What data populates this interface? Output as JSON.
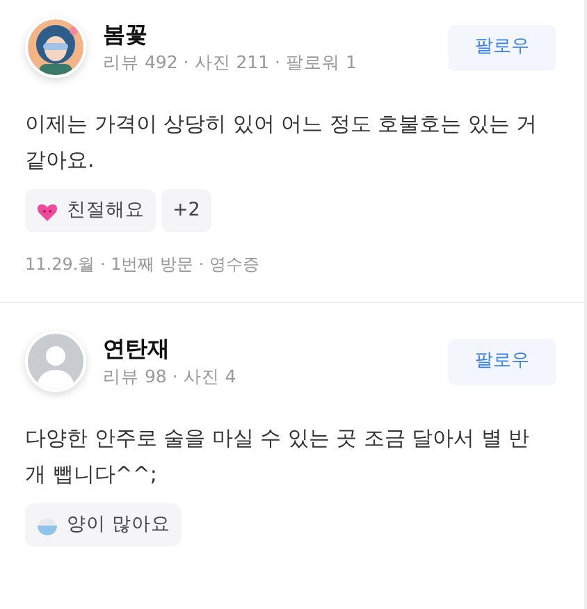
{
  "reviews": [
    {
      "name": "봄꽃",
      "stats": "리뷰 492 · 사진 211 · 팔로워 1",
      "follow": "팔로우",
      "text": "이제는 가격이 상당히 있어 어느 정도 호불호는 있는 거 같아요.",
      "keywords": [
        {
          "kind": "heart",
          "label": "친절해요"
        },
        {
          "kind": "more",
          "label": "+2"
        }
      ],
      "footer": "11.29.월 · 1번째 방문 · 영수증"
    },
    {
      "avatar": {
        "kind": "default"
      },
      "name": "연탄재",
      "stats": "리뷰 98 · 사진 4",
      "follow": "팔로우",
      "text": "다양한 안주로 술을 마실 수 있는 곳 조금 달아서 별 반 개 뺍니다^^;",
      "keywords": [
        {
          "kind": "bowl",
          "label": "양이 많아요"
        }
      ]
    }
  ]
}
